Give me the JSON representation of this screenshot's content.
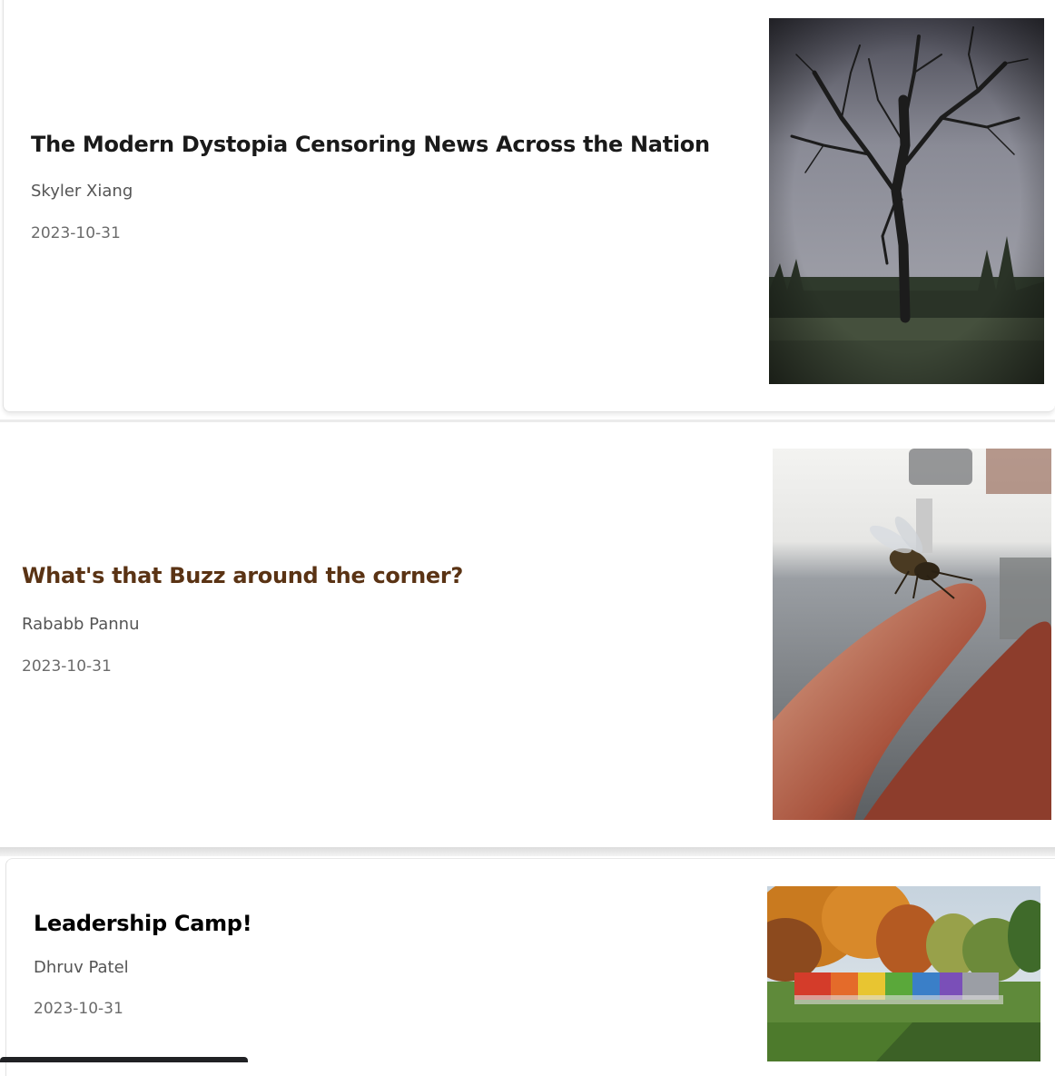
{
  "articles": [
    {
      "title": "The Modern Dystopia Censoring News Across the Nation",
      "author": "Skyler Xiang",
      "date": "2023-10-31",
      "image": "bare-tree-photo",
      "title_color": "#1a1a1a"
    },
    {
      "title": "What's that Buzz around the corner?",
      "author": "Rababb Pannu",
      "date": "2023-10-31",
      "image": "bee-on-finger-photo",
      "title_color": "#5a3314"
    },
    {
      "title": "Leadership Camp!",
      "author": "Dhruv Patel",
      "date": "2023-10-31",
      "image": "group-photo-autumn-trees",
      "title_color": "#000000"
    }
  ]
}
